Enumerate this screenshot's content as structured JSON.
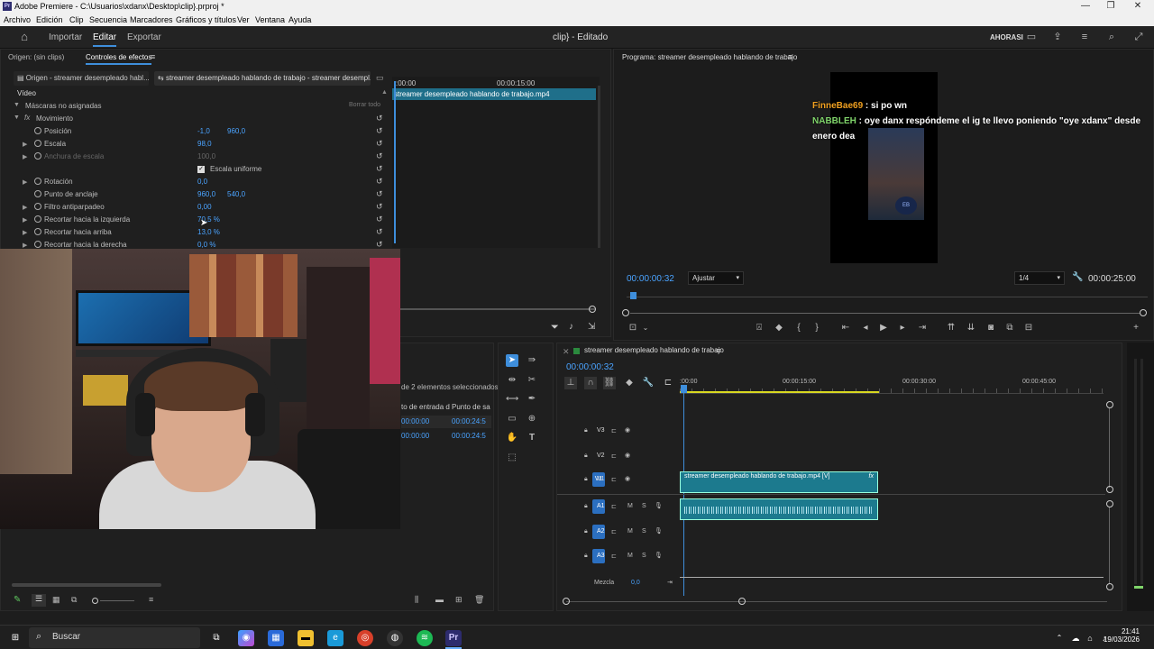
{
  "window": {
    "title": "Adobe Premiere - C:\\Usuarios\\xdanx\\Desktop\\clip}.prproj *",
    "app_badge": "Pr",
    "controls": [
      "—",
      "❐",
      "✕"
    ]
  },
  "menu": [
    "Archivo",
    "Edición",
    "Clip",
    "Secuencia",
    "Marcadores",
    "Gráficos y títulos",
    "Ver",
    "Ventana",
    "Ayuda"
  ],
  "header": {
    "tabs": [
      "Importar",
      "Editar",
      "Exportar"
    ],
    "project_title": "clip} - Editado",
    "workspace": "AHORASI"
  },
  "source_panel": {
    "tab_origin": "Origen: (sin clips)",
    "tab_effects": "Controles de efectos",
    "sub_tab_origin": "Origen - streamer desempleado habl...",
    "sub_tab_sequence": "streamer desempleado hablando de trabajo - streamer desempl...",
    "mini_time_start": ":00:00",
    "mini_time_mid": "00:00:15:00",
    "mini_clip_label": "streamer desempleado hablando de trabajo.mp4",
    "section_video": "Vídeo",
    "masks_label": "Máscaras no asignadas",
    "clear_all": "Borrar todo",
    "motion_label": "Movimiento",
    "properties": [
      {
        "label": "Posición",
        "v1": "-1,0",
        "v2": "960,0",
        "chev": false
      },
      {
        "label": "Escala",
        "v1": "98,0",
        "v2": "",
        "chev": true
      },
      {
        "label": "Anchura de escala",
        "v1": "100,0",
        "v2": "",
        "chev": true,
        "dim": true
      },
      {
        "label": "Escala uniforme",
        "v1": "",
        "v2": "",
        "checkbox": true
      },
      {
        "label": "Rotación",
        "v1": "0,0",
        "v2": "",
        "chev": true
      },
      {
        "label": "Punto de anclaje",
        "v1": "960,0",
        "v2": "540,0",
        "chev": false
      },
      {
        "label": "Filtro antiparpadeo",
        "v1": "0,00",
        "v2": "",
        "chev": true
      },
      {
        "label": "Recortar hacia la izquierda",
        "v1": "70,5 %",
        "v2": "",
        "chev": true
      },
      {
        "label": "Recortar hacia arriba",
        "v1": "13,0 %",
        "v2": "",
        "chev": true
      },
      {
        "label": "Recortar hacia la derecha",
        "v1": "0,0 %",
        "v2": "",
        "chev": true
      }
    ]
  },
  "project_panel": {
    "selection_text": "de 2 elementos seleccionados",
    "col_in": "to de entrada d",
    "col_out": "Punto de sa",
    "rows": [
      {
        "in": "00:00:00",
        "out": "00:00:24:5"
      },
      {
        "in": "00:00:00",
        "out": "00:00:24:5"
      }
    ]
  },
  "program_monitor": {
    "title": "Programa: streamer desempleado hablando de trabajo",
    "chat": [
      {
        "user": "FinneBae69",
        "user_color": "#f0a020",
        "msg": " : si po wn"
      },
      {
        "user": "NABBLEH",
        "user_color": "#7fd46a",
        "msg": " : oye danx respóndeme el ig te llevo poniendo \"oye xdanx\" desde"
      },
      {
        "user": "",
        "user_color": "#ffffff",
        "msg": "enero dea"
      }
    ],
    "timecode": "00:00:00:32",
    "fit": "Ajustar",
    "resolution": "1/4",
    "duration": "00:00:25:00"
  },
  "timeline": {
    "sequence_name": "streamer desempleado hablando de trabajo",
    "timecode": "00:00:00:32",
    "ruler": [
      ":00:00",
      "00:00:15:00",
      "00:00:30:00",
      "00:00:45:00"
    ],
    "video_tracks": [
      "V3",
      "V2",
      "V1"
    ],
    "audio_tracks": [
      "A1",
      "A2",
      "A3"
    ],
    "video_clip_label": "streamer desempleado hablando de trabajo.mp4 [V]",
    "mix_label": "Mezcla",
    "mix_value": "0,0"
  },
  "taskbar": {
    "search_placeholder": "Buscar",
    "time": "21:41",
    "date": "19/03/2026"
  }
}
